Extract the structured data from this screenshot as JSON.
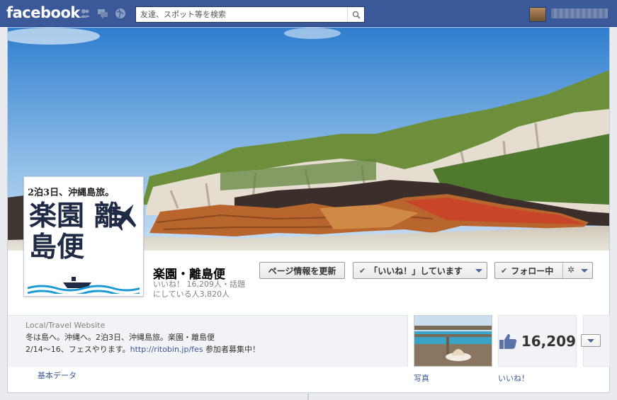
{
  "topbar": {
    "logo": "facebook",
    "search_placeholder": "友達、スポット等を検索",
    "icons": [
      "friends-icon",
      "messages-icon",
      "notifications-icon",
      "search-icon"
    ]
  },
  "page": {
    "name": "楽園・離島便",
    "stats_line1": "いいね！ 16,209人・話題",
    "stats_line2": "にしている人3,820人"
  },
  "profile_pic": {
    "tagline": "2泊3日、沖縄島旅。",
    "title": "楽園 離島便"
  },
  "buttons": {
    "update": "ページ情報を更新",
    "liked": "「いいね！」しています",
    "follow": "フォロー中"
  },
  "about": {
    "category": "Local/Travel Website",
    "description_line1": "冬は島へ。沖縄へ。2泊3日、沖縄島旅。楽園・離島便",
    "description_line2_prefix": "2/14〜16、フェスやります。",
    "description_link": "http://ritobin.jp/fes",
    "description_line2_suffix": " 参加者募集中！",
    "basic_data": "基本データ"
  },
  "apps": {
    "photos_label": "写真",
    "likes_count": "16,209",
    "likes_label": "いいね！"
  },
  "colors": {
    "brand": "#3b5998",
    "background": "#e9ebee"
  }
}
